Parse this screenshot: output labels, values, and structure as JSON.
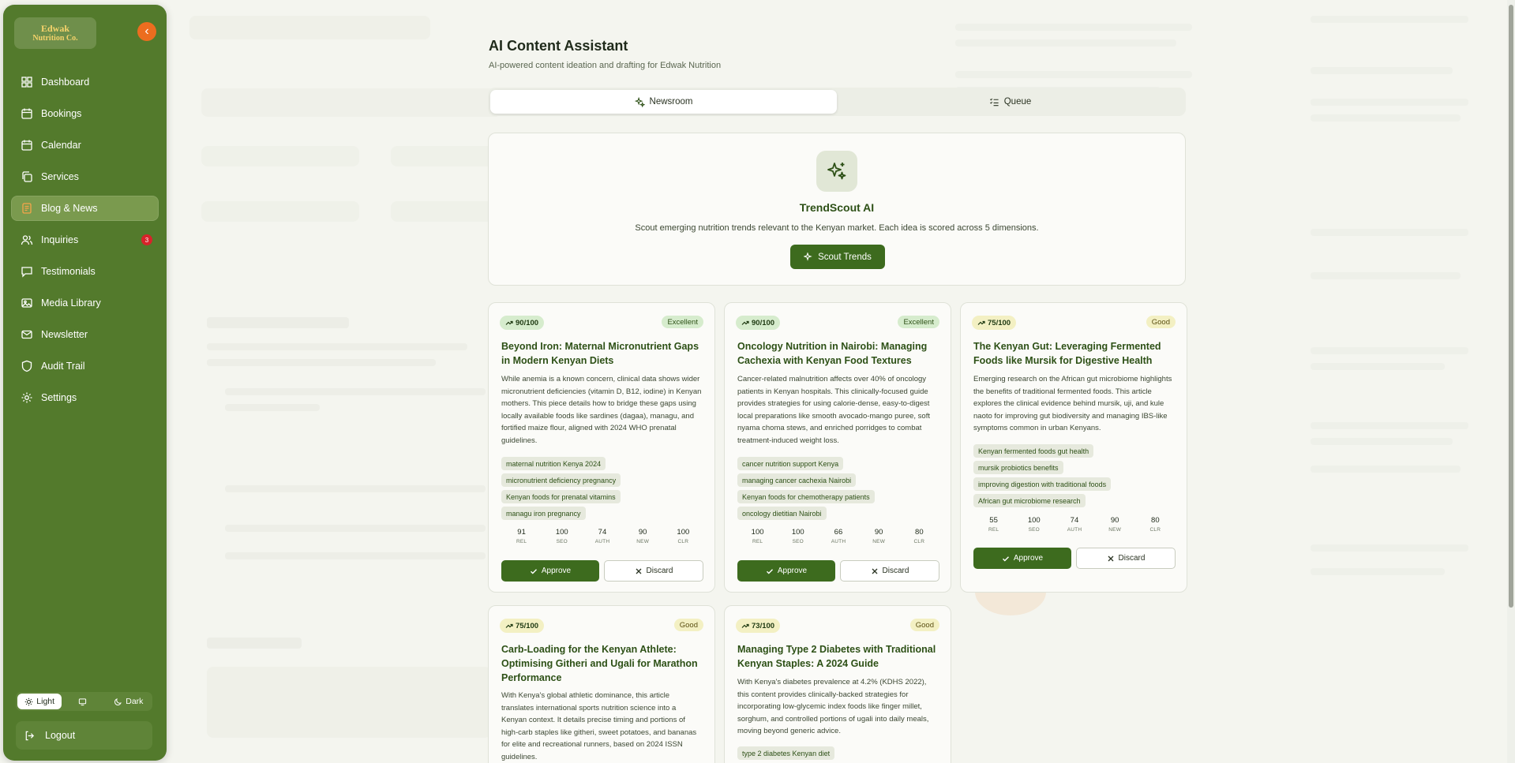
{
  "brand": {
    "logo_line1": "Edwak",
    "logo_line2": "Nutrition Co."
  },
  "sidebar": {
    "collapse_icon": "chevron-left-icon",
    "items": [
      {
        "label": "Dashboard",
        "icon": "dashboard-icon"
      },
      {
        "label": "Bookings",
        "icon": "calendar-icon"
      },
      {
        "label": "Calendar",
        "icon": "calendar-icon"
      },
      {
        "label": "Services",
        "icon": "copy-icon"
      },
      {
        "label": "Blog & News",
        "icon": "document-icon",
        "active": true
      },
      {
        "label": "Inquiries",
        "icon": "users-icon",
        "badge": "3"
      },
      {
        "label": "Testimonials",
        "icon": "message-icon"
      },
      {
        "label": "Media Library",
        "icon": "image-icon"
      },
      {
        "label": "Newsletter",
        "icon": "mail-icon"
      },
      {
        "label": "Audit Trail",
        "icon": "shield-icon"
      },
      {
        "label": "Settings",
        "icon": "gear-icon"
      }
    ],
    "theme": {
      "light": "Light",
      "system_icon": "monitor-icon",
      "dark": "Dark"
    },
    "logout": "Logout"
  },
  "main": {
    "title": "AI Content Assistant",
    "subtitle": "AI-powered content ideation and drafting for Edwak Nutrition",
    "tabs": [
      {
        "label": "Newsroom",
        "icon": "sparkles-icon",
        "selected": true
      },
      {
        "label": "Queue",
        "icon": "list-icon"
      }
    ],
    "hero": {
      "icon": "sparkles-icon",
      "title": "TrendScout AI",
      "description": "Scout emerging nutrition trends relevant to the Kenyan market. Each idea is scored across 5 dimensions.",
      "button": "Scout Trends"
    },
    "metric_labels": [
      "REL",
      "SEO",
      "AUTH",
      "NEW",
      "CLR"
    ],
    "approve_label": "Approve",
    "discard_label": "Discard",
    "ideas": [
      {
        "score": "90/100",
        "rating": "Excellent",
        "title": "Beyond Iron: Maternal Micronutrient Gaps in Modern Kenyan Diets",
        "description": "While anemia is a known concern, clinical data shows wider micronutrient deficiencies (vitamin D, B12, iodine) in Kenyan mothers. This piece details how to bridge these gaps using locally available foods like sardines (dagaa), managu, and fortified maize flour, aligned with 2024 WHO prenatal guidelines.",
        "tags": [
          "maternal nutrition Kenya 2024",
          "micronutrient deficiency pregnancy",
          "Kenyan foods for prenatal vitamins",
          "managu iron pregnancy"
        ],
        "metrics": [
          "91",
          "100",
          "74",
          "90",
          "100"
        ]
      },
      {
        "score": "90/100",
        "rating": "Excellent",
        "title": "Oncology Nutrition in Nairobi: Managing Cachexia with Kenyan Food Textures",
        "description": "Cancer-related malnutrition affects over 40% of oncology patients in Kenyan hospitals. This clinically-focused guide provides strategies for using calorie-dense, easy-to-digest local preparations like smooth avocado-mango puree, soft nyama choma stews, and enriched porridges to combat treatment-induced weight loss.",
        "tags": [
          "cancer nutrition support Kenya",
          "managing cancer cachexia Nairobi",
          "Kenyan foods for chemotherapy patients",
          "oncology dietitian Nairobi"
        ],
        "metrics": [
          "100",
          "100",
          "66",
          "90",
          "80"
        ]
      },
      {
        "score": "75/100",
        "rating": "Good",
        "title": "The Kenyan Gut: Leveraging Fermented Foods like Mursik for Digestive Health",
        "description": "Emerging research on the African gut microbiome highlights the benefits of traditional fermented foods. This article explores the clinical evidence behind mursik, uji, and kule naoto for improving gut biodiversity and managing IBS-like symptoms common in urban Kenyans.",
        "tags": [
          "Kenyan fermented foods gut health",
          "mursik probiotics benefits",
          "improving digestion with traditional foods",
          "African gut microbiome research"
        ],
        "metrics": [
          "55",
          "100",
          "74",
          "90",
          "80"
        ]
      },
      {
        "score": "75/100",
        "rating": "Good",
        "title": "Carb-Loading for the Kenyan Athlete: Optimising Githeri and Ugali for Marathon Performance",
        "description": "With Kenya's global athletic dominance, this article translates international sports nutrition science into a Kenyan context. It details precise timing and portions of high-carb staples like githeri, sweet potatoes, and bananas for elite and recreational runners, based on 2024 ISSN guidelines.",
        "tags": [],
        "metrics": []
      },
      {
        "score": "73/100",
        "rating": "Good",
        "title": "Managing Type 2 Diabetes with Traditional Kenyan Staples: A 2024 Guide",
        "description": "With Kenya's diabetes prevalence at 4.2% (KDHS 2022), this content provides clinically-backed strategies for incorporating low-glycemic index foods like finger millet, sorghum, and controlled portions of ugali into daily meals, moving beyond generic advice.",
        "tags": [
          "type 2 diabetes Kenyan diet"
        ],
        "metrics": []
      }
    ]
  },
  "colors": {
    "sidebar": "#537a2c",
    "accent": "#3d6b1e",
    "orange": "#ec6d1f",
    "badge": "#d8232a"
  }
}
